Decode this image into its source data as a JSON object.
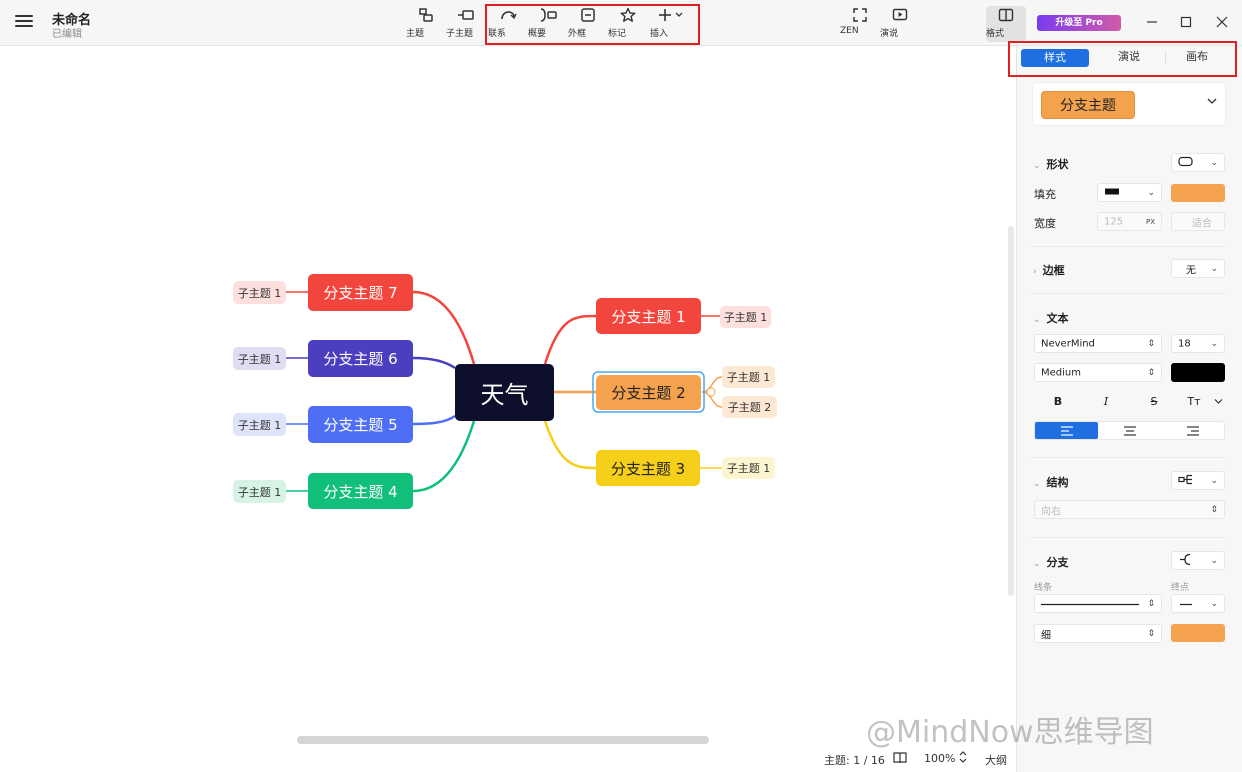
{
  "header": {
    "doc_title": "未命名",
    "doc_status": "已编辑",
    "tools": {
      "topic": "主题",
      "subtopic": "子主题",
      "relation": "联系",
      "summary": "概要",
      "boundary": "外框",
      "marker": "标记",
      "insert": "插入",
      "zen": "ZEN",
      "present": "演说",
      "format": "格式"
    },
    "upgrade_label": "升级至 Pro"
  },
  "mindmap": {
    "root": "天气",
    "branches": {
      "b1": "分支主题 1",
      "b2": "分支主题 2",
      "b3": "分支主题 3",
      "b4": "分支主题 4",
      "b5": "分支主题 5",
      "b6": "分支主题 6",
      "b7": "分支主题 7"
    },
    "subtopics": {
      "b1_s1": "子主题 1",
      "b2_s1": "子主题 1",
      "b2_s2": "子主题 2",
      "b3_s1": "子主题 1",
      "b4_s1": "子主题 1",
      "b5_s1": "子主题 1",
      "b6_s1": "子主题 1",
      "b7_s1": "子主题 1"
    },
    "colors": {
      "b1": "#f2453d",
      "b2": "#f5a24e",
      "b3": "#f5cf1a",
      "b4": "#0fbf7a",
      "b5": "#4d6ef5",
      "b6": "#4b3fc0",
      "b7": "#f2453d",
      "root": "#0d0f2c"
    }
  },
  "statusbar": {
    "topic_count": "主题: 1 / 16",
    "zoom": "100%",
    "outline": "大纲"
  },
  "panel": {
    "tabs": [
      "样式",
      "演说",
      "画布"
    ],
    "style_preview": "分支主题",
    "shape": {
      "title": "形状",
      "fill_label": "填充",
      "width_label": "宽度",
      "width_value": "125",
      "width_unit": "PX",
      "fit_label": "适合"
    },
    "border": {
      "title": "边框",
      "value": "无"
    },
    "text": {
      "title": "文本",
      "font": "NeverMind",
      "size": "18",
      "weight": "Medium",
      "bold": "B",
      "italic": "I",
      "strike": "S",
      "case": "Tт"
    },
    "structure": {
      "title": "结构",
      "direction": "向右"
    },
    "branch": {
      "title": "分支",
      "line_label": "线条",
      "end_label": "终点",
      "thickness": "细"
    },
    "accent": "#1f6fe0",
    "fill_color": "#f5a24e",
    "text_color": "#000000"
  },
  "watermark": "@MindNow思维导图"
}
